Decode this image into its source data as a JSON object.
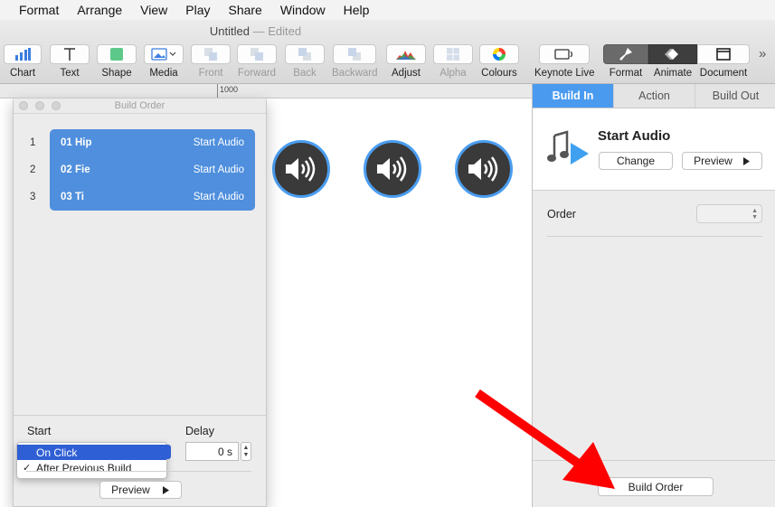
{
  "menu": [
    "Format",
    "Arrange",
    "View",
    "Play",
    "Share",
    "Window",
    "Help"
  ],
  "window": {
    "title": "Untitled",
    "status": "— Edited"
  },
  "toolbar": {
    "chart": "Chart",
    "text": "Text",
    "shape": "Shape",
    "media": "Media",
    "front": "Front",
    "forward": "Forward",
    "back": "Back",
    "backward": "Backward",
    "adjust": "Adjust",
    "alpha": "Alpha",
    "colours": "Colours",
    "keynote_live": "Keynote Live",
    "format": "Format",
    "animate": "Animate",
    "document": "Document",
    "more": "»"
  },
  "ruler": {
    "mark": "1000"
  },
  "build_order": {
    "title": "Build Order",
    "builds": [
      {
        "num": "1",
        "name": "01 Hip",
        "action": "Start Audio"
      },
      {
        "num": "2",
        "name": "02 Fie",
        "action": "Start Audio"
      },
      {
        "num": "3",
        "name": "03 Ti",
        "action": "Start Audio"
      }
    ],
    "start_label": "Start",
    "delay_label": "Delay",
    "delay_value": "0 s",
    "start_options": {
      "selected": "On Click",
      "checked": "After Previous Build",
      "checkmark": "✓"
    },
    "preview": "Preview"
  },
  "inspector": {
    "tabs": [
      "Build In",
      "Action",
      "Build Out"
    ],
    "active_tab": "Build In",
    "effect_title": "Start Audio",
    "change": "Change",
    "preview": "Preview",
    "order_label": "Order",
    "build_order_button": "Build Order"
  },
  "colors": {
    "accent": "#4a9bf0",
    "build_row": "#4f8fdd",
    "arrow": "#ff0000",
    "menu_highlight": "#2f5fd4"
  }
}
